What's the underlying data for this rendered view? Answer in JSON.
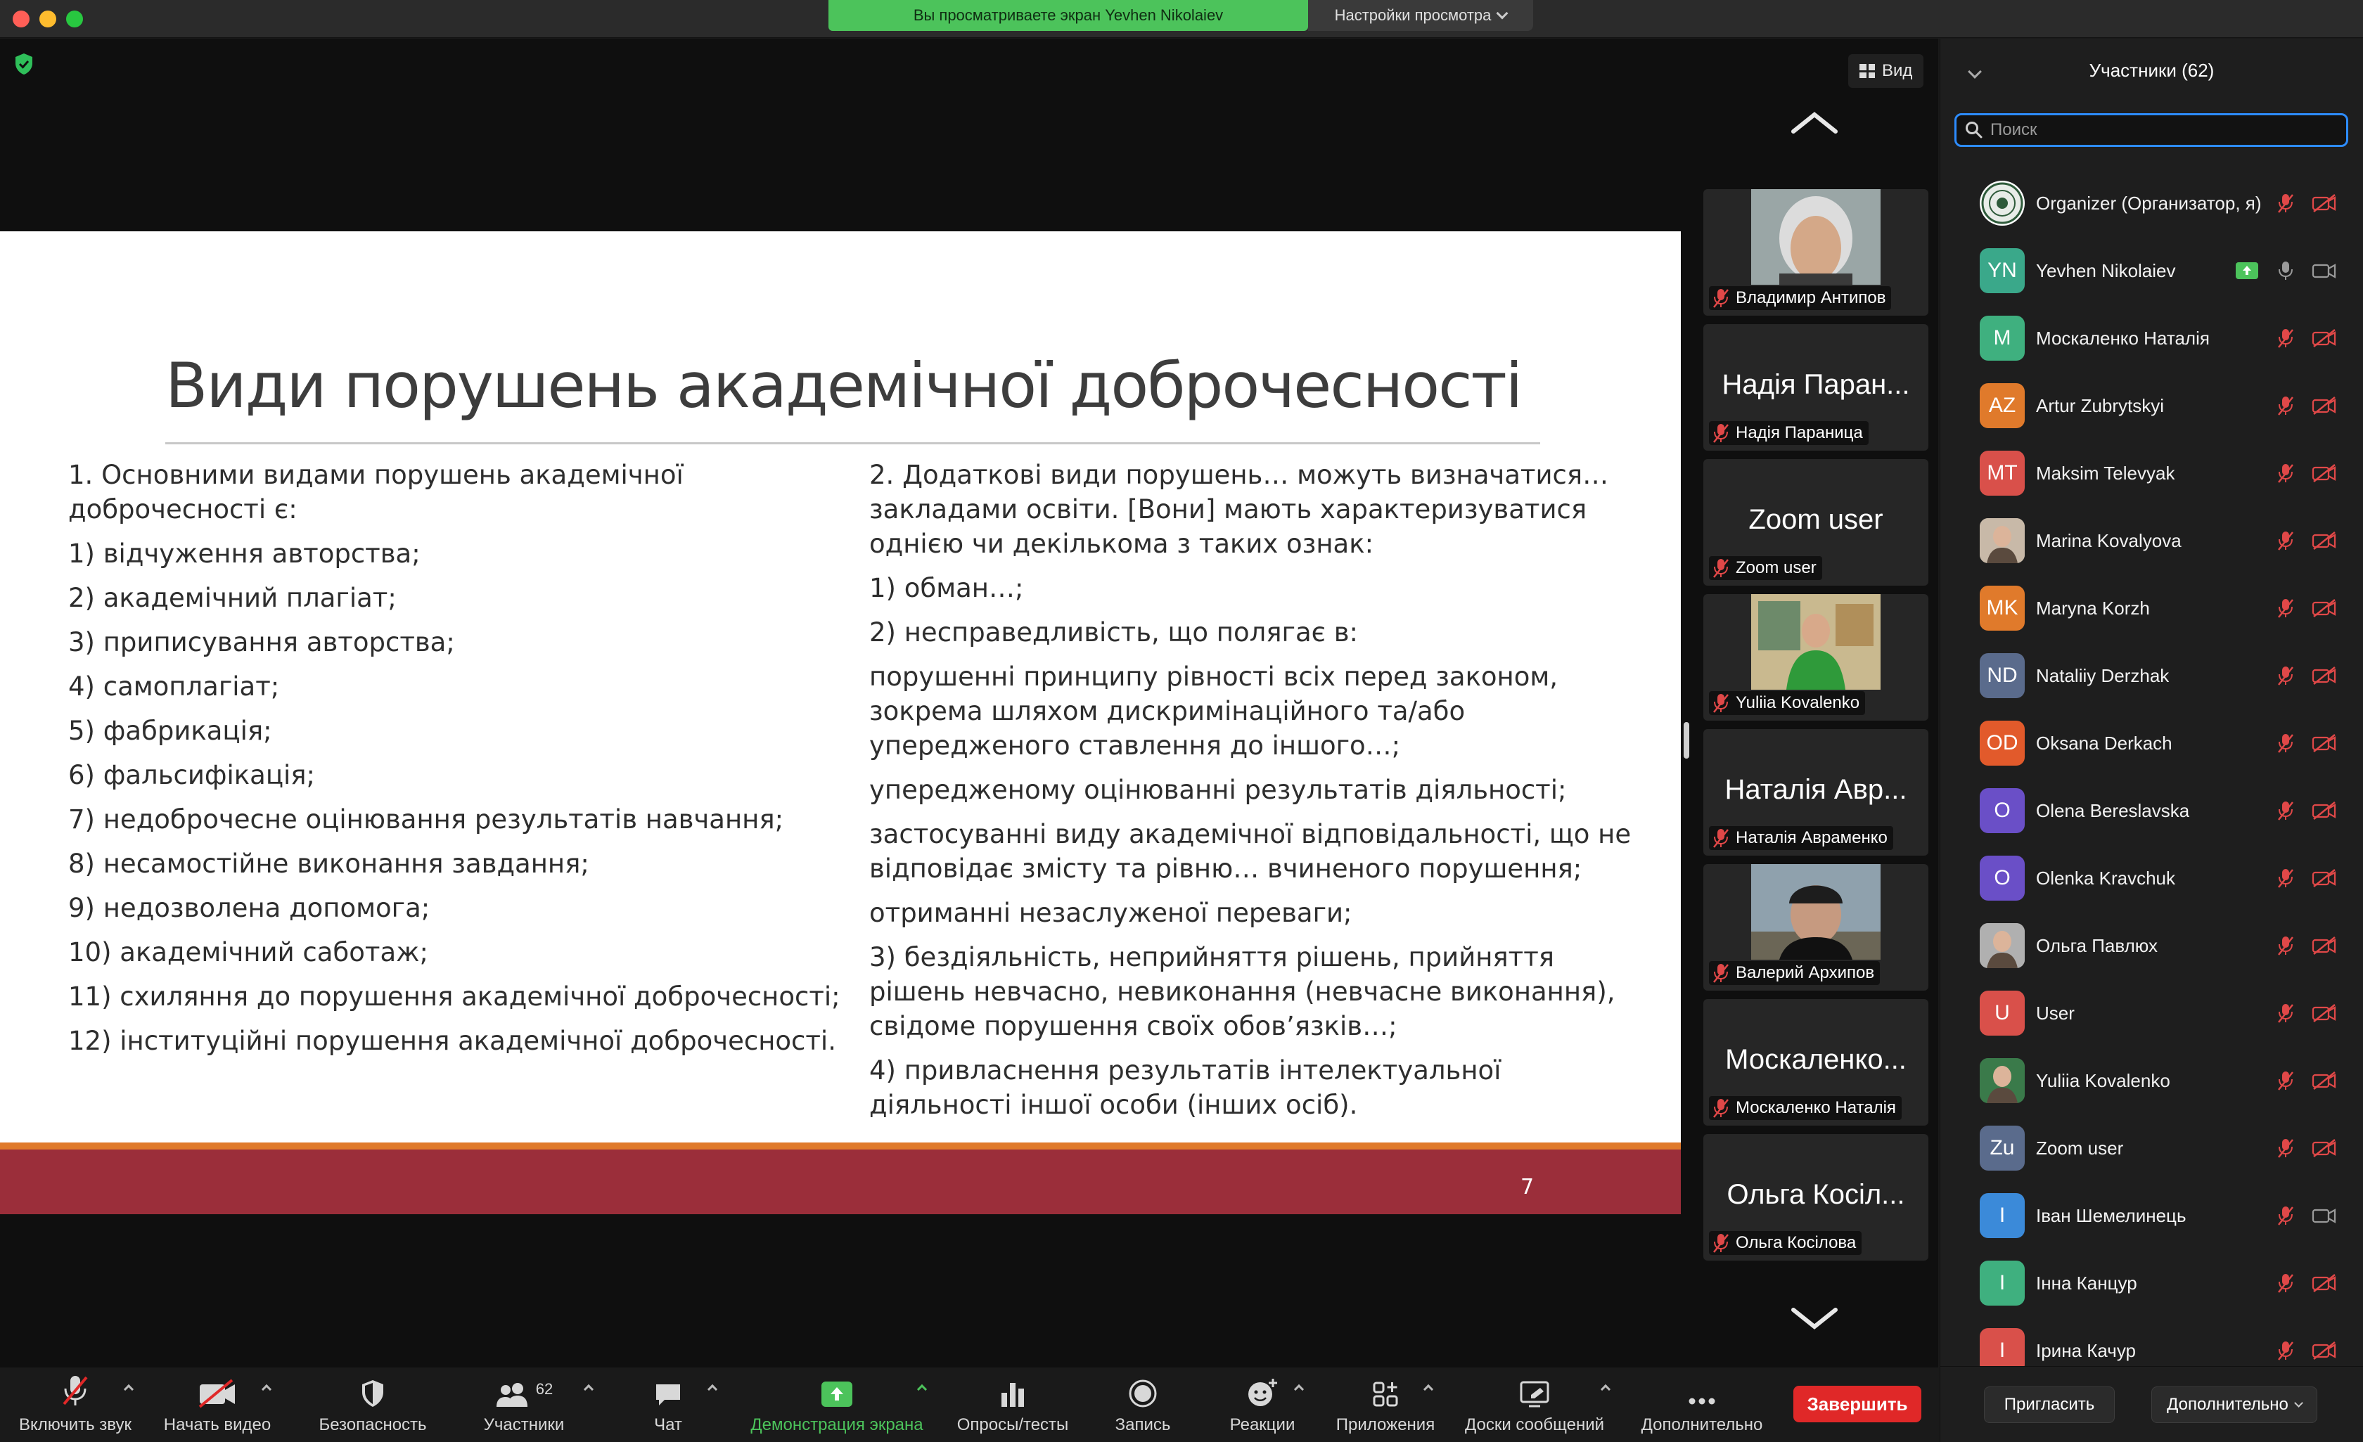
{
  "titlebar": {
    "share_banner": "Вы просматриваете экран Yevhen Nikolaiev",
    "view_settings": "Настройки просмотра"
  },
  "stage": {
    "view_label": "Вид"
  },
  "slide": {
    "title": "Види порушень академічної доброчесності",
    "left_items": [
      "1. Основними видами порушень академічної доброчесності є:",
      "1) відчуження авторства;",
      "2) академічний плагіат;",
      "3) приписування авторства;",
      "4) самоплагіат;",
      "5) фабрикація;",
      "6) фальсифікація;",
      "7) недоброчесне оцінювання результатів навчання;",
      "8) несамостійне виконання завдання;",
      "9) недозволена допомога;",
      "10) академічний саботаж;",
      "11) схиляння до порушення академічної доброчесності;",
      "12) інституційні порушення академічної доброчесності."
    ],
    "right_items": [
      "2. Додаткові види порушень… можуть визначатися… закладами освіти. [Вони] мають характеризуватися однією чи декількома з таких ознак:",
      "1) обман…;",
      "2) несправедливість, що полягає в:",
      "порушенні принципу рівності всіх перед законом, зокрема шляхом дискримінаційного та/або упередженого ставлення до іншого…;",
      "упередженому оцінюванні результатів діяльності;",
      "застосуванні виду академічної відповідальності, що не відповідає змісту та рівню… вчиненого порушення;",
      "отриманні незаслуженої переваги;",
      "3) бездіяльність, неприйняття рішень, прийняття рішень невчасно, невиконання (невчасне виконання), свідоме порушення своїх обов’язків…;",
      "4) привласнення результатів інтелектуальної діяльності іншої особи (інших осіб)."
    ],
    "page_number": "7"
  },
  "thumbnails": [
    {
      "big": "",
      "label": "Владимир Антипов",
      "photo": "gray-hair"
    },
    {
      "big": "Надія Паран...",
      "label": "Надія Параница",
      "photo": ""
    },
    {
      "big": "Zoom user",
      "label": "Zoom user",
      "photo": ""
    },
    {
      "big": "",
      "label": "Yuliia Kovalenko",
      "photo": "green-office"
    },
    {
      "big": "Наталія Авр...",
      "label": "Наталія Авраменко",
      "photo": ""
    },
    {
      "big": "",
      "label": "Валерий Архипов",
      "photo": "black-hat"
    },
    {
      "big": "Москаленко...",
      "label": "Москаленко Наталія",
      "photo": ""
    },
    {
      "big": "Ольга Косіл...",
      "label": "Ольга Косілова",
      "photo": ""
    }
  ],
  "sidebar": {
    "title": "Участники (62)",
    "search_placeholder": "Поиск",
    "participants": [
      {
        "initials": "",
        "name": "Organizer (Организатор, я)",
        "color": "#ffffff",
        "avatar": "seal",
        "mic": "muted",
        "cam": "off"
      },
      {
        "initials": "YN",
        "name": "Yevhen Nikolaiev",
        "color": "#3aa88a",
        "avatar": "initials",
        "mic": "on",
        "cam": "on",
        "sharing": true
      },
      {
        "initials": "M",
        "name": " Москаленко Наталія",
        "color": "#3fb07f",
        "avatar": "initials",
        "mic": "muted",
        "cam": "off"
      },
      {
        "initials": "AZ",
        "name": "Artur Zubrytskyi",
        "color": "#e07a2b",
        "avatar": "initials",
        "mic": "muted",
        "cam": "off"
      },
      {
        "initials": "MT",
        "name": "Maksim Televyak",
        "color": "#d9504a",
        "avatar": "initials",
        "mic": "muted",
        "cam": "off"
      },
      {
        "initials": "",
        "name": "Marina Kovalyova",
        "color": "#c8b9a8",
        "avatar": "photo",
        "mic": "muted",
        "cam": "off"
      },
      {
        "initials": "MK",
        "name": "Maryna Korzh",
        "color": "#e07a2b",
        "avatar": "initials",
        "mic": "muted",
        "cam": "off"
      },
      {
        "initials": "ND",
        "name": "Nataliiy Derzhak",
        "color": "#5a6b8c",
        "avatar": "initials",
        "mic": "muted",
        "cam": "off"
      },
      {
        "initials": "OD",
        "name": "Oksana Derkach",
        "color": "#e25a2b",
        "avatar": "initials",
        "mic": "muted",
        "cam": "off"
      },
      {
        "initials": "O",
        "name": "Olena Bereslavska",
        "color": "#6a4fc7",
        "avatar": "initials",
        "mic": "muted",
        "cam": "off"
      },
      {
        "initials": "O",
        "name": "Olenka Kravchuk",
        "color": "#6a4fc7",
        "avatar": "initials",
        "mic": "muted",
        "cam": "off"
      },
      {
        "initials": "",
        "name": "Ольга Павлюх",
        "color": "#b0b0b0",
        "avatar": "photo",
        "mic": "muted",
        "cam": "off"
      },
      {
        "initials": "U",
        "name": "User",
        "color": "#d9504a",
        "avatar": "initials",
        "mic": "muted",
        "cam": "off"
      },
      {
        "initials": "",
        "name": "Yuliia Kovalenko",
        "color": "#3a7a4a",
        "avatar": "photo",
        "mic": "muted",
        "cam": "off"
      },
      {
        "initials": "Zu",
        "name": "Zoom user",
        "color": "#5a6b8c",
        "avatar": "initials",
        "mic": "muted",
        "cam": "off"
      },
      {
        "initials": "І",
        "name": "Іван Шемелинець",
        "color": "#3b8ad9",
        "avatar": "initials",
        "mic": "muted",
        "cam": "on"
      },
      {
        "initials": "І",
        "name": "Інна Канцур",
        "color": "#3fb07f",
        "avatar": "initials",
        "mic": "muted",
        "cam": "off"
      },
      {
        "initials": "І",
        "name": "Ірина Качур",
        "color": "#d9504a",
        "avatar": "initials",
        "mic": "muted",
        "cam": "off"
      }
    ],
    "invite_label": "Пригласить",
    "more_label": "Дополнительно"
  },
  "toolbar": {
    "items": [
      {
        "label": "Включить звук"
      },
      {
        "label": "Начать видео"
      },
      {
        "label": "Безопасность"
      },
      {
        "label": "Участники",
        "count": "62"
      },
      {
        "label": "Чат"
      },
      {
        "label": "Демонстрация экрана"
      },
      {
        "label": "Опросы/тесты"
      },
      {
        "label": "Запись"
      },
      {
        "label": "Реакции"
      },
      {
        "label": "Приложения"
      },
      {
        "label": "Доски сообщений"
      },
      {
        "label": "Дополнительно"
      }
    ],
    "end_label": "Завершить"
  },
  "colors": {
    "accent_blue": "#2d8cff",
    "share_green": "#4cc35b",
    "end_red": "#e02828",
    "slide_footer": "#9b2e3a",
    "slide_accent": "#e07a2b"
  }
}
